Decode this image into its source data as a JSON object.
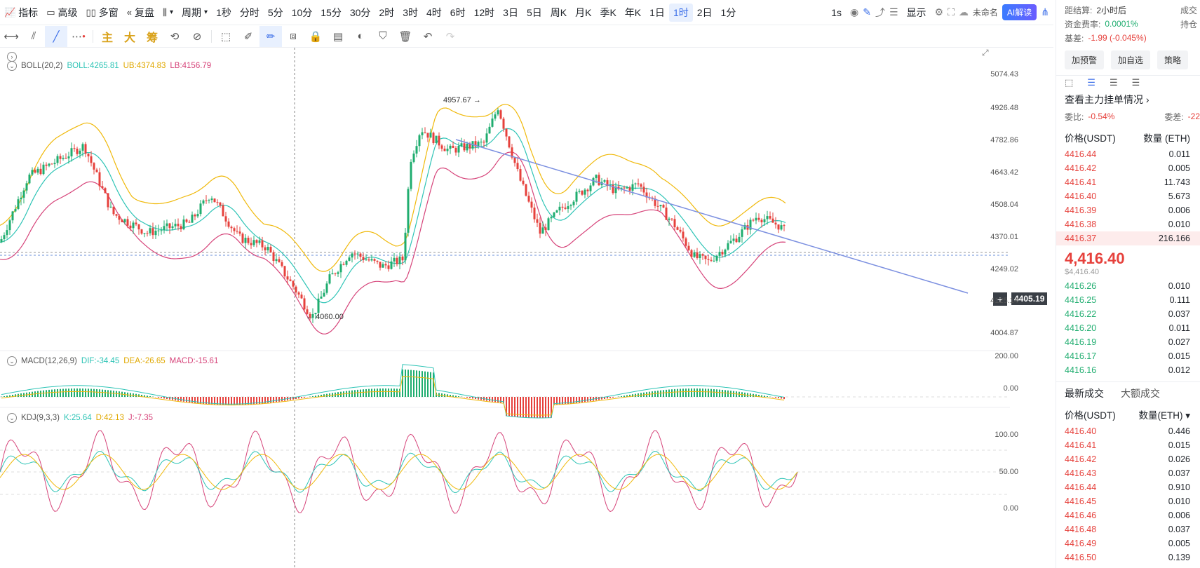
{
  "toolbar": {
    "indicators": "指标",
    "advanced": "高级",
    "multiwindow": "多窗",
    "replay": "复盘",
    "period": "周期",
    "timeframes": [
      "1秒",
      "分时",
      "5分",
      "10分",
      "15分",
      "30分",
      "2时",
      "3时",
      "4时",
      "6时",
      "12时",
      "3日",
      "5日",
      "周K",
      "月K",
      "季K",
      "年K",
      "1日",
      "1时",
      "2日",
      "1分"
    ],
    "active_timeframe": "1时",
    "interval": "1s",
    "display": "显示",
    "unnamed": "未命名",
    "ai": "AI解读"
  },
  "drawbar": {
    "main": "主",
    "big": "大",
    "fund": "筹"
  },
  "legends": {
    "boll": {
      "name": "BOLL(20,2)",
      "boll": "BOLL:4265.81",
      "ub": "UB:4374.83",
      "lb": "LB:4156.79"
    },
    "macd": {
      "name": "MACD(12,26,9)",
      "dif": "DIF:-34.45",
      "dea": "DEA:-26.65",
      "macd": "MACD:-15.61"
    },
    "kdj": {
      "name": "KDJ(9,3,3)",
      "k": "K:25.64",
      "d": "D:42.13",
      "j": "J:-7.35"
    }
  },
  "annotations": {
    "high": "4957.67",
    "low": "4060.00",
    "current": "4405.19"
  },
  "axis": {
    "main": [
      "5074.43",
      "4926.48",
      "4782.86",
      "4643.42",
      "4508.04",
      "4370.01",
      "4249.02",
      "4125.14",
      "4004.87"
    ],
    "macd": [
      "200.00",
      "0.00"
    ],
    "kdj": [
      "100.00",
      "50.00",
      "0.00"
    ]
  },
  "right_panel": {
    "settle_label": "距结算:",
    "settle_value": "2小时后",
    "volume_label": "成交",
    "funding_label": "资金费率:",
    "funding_value": "0.0001%",
    "oi_label": "持仓",
    "basis_label": "基差:",
    "basis_value": "-1.99 (-0.045%)",
    "btn_alert": "加预警",
    "btn_watch": "加自选",
    "btn_strategy": "策略",
    "orderbook_title": "查看主力挂单情况 ›",
    "ratio_label": "委比:",
    "ratio_value": "-0.54%",
    "diff_label": "委差:",
    "diff_value": "-22",
    "col_price": "价格(USDT)",
    "col_qty": "数量 (ETH)",
    "asks": [
      {
        "p": "4416.44",
        "q": "0.011"
      },
      {
        "p": "4416.42",
        "q": "0.005"
      },
      {
        "p": "4416.41",
        "q": "11.743"
      },
      {
        "p": "4416.40",
        "q": "5.673"
      },
      {
        "p": "4416.39",
        "q": "0.006"
      },
      {
        "p": "4416.38",
        "q": "0.010"
      },
      {
        "p": "4416.37",
        "q": "216.166"
      }
    ],
    "last_price": "4,416.40",
    "last_sub": "$4,416.40",
    "bids": [
      {
        "p": "4416.26",
        "q": "0.010"
      },
      {
        "p": "4416.25",
        "q": "0.111"
      },
      {
        "p": "4416.22",
        "q": "0.037"
      },
      {
        "p": "4416.20",
        "q": "0.011"
      },
      {
        "p": "4416.19",
        "q": "0.027"
      },
      {
        "p": "4416.17",
        "q": "0.015"
      },
      {
        "p": "4416.16",
        "q": "0.012"
      }
    ],
    "tab_latest": "最新成交",
    "tab_large": "大额成交",
    "trades_col_price": "价格(USDT)",
    "trades_col_qty": "数量(ETH) ▾",
    "trades": [
      {
        "p": "4416.40",
        "q": "0.446"
      },
      {
        "p": "4416.41",
        "q": "0.015"
      },
      {
        "p": "4416.42",
        "q": "0.026"
      },
      {
        "p": "4416.43",
        "q": "0.037"
      },
      {
        "p": "4416.44",
        "q": "0.910"
      },
      {
        "p": "4416.45",
        "q": "0.010"
      },
      {
        "p": "4416.46",
        "q": "0.006"
      },
      {
        "p": "4416.48",
        "q": "0.037"
      },
      {
        "p": "4416.49",
        "q": "0.005"
      },
      {
        "p": "4416.50",
        "q": "0.139"
      }
    ]
  },
  "colors": {
    "up": "#1fad6f",
    "down": "#e6413c",
    "boll_mid": "#2ec4b6",
    "boll_ub": "#f0b90b",
    "boll_lb": "#d6447a",
    "trendline": "#7b8fe0"
  }
}
